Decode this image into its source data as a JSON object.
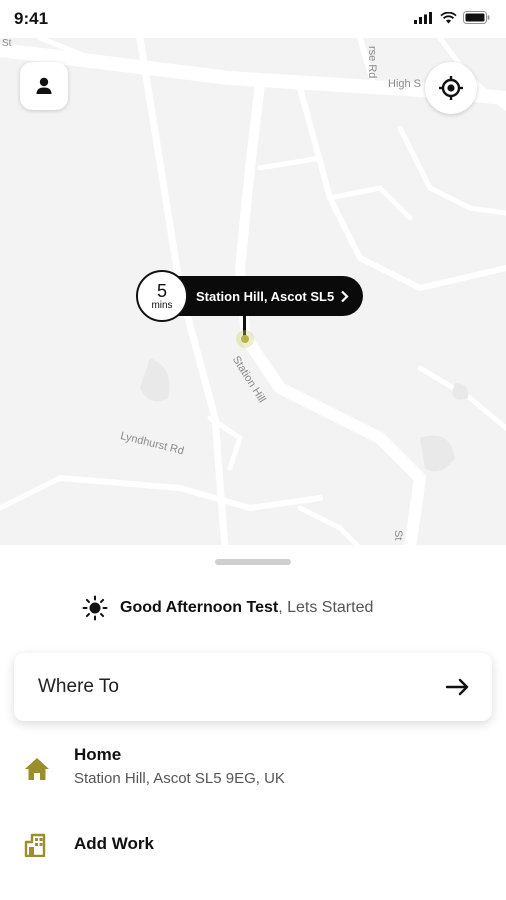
{
  "status_bar": {
    "time": "9:41"
  },
  "map": {
    "labels": {
      "st_top_left": "St",
      "rose_rd": "rse Rd",
      "high_st": "High S",
      "station_hill": "Station Hill",
      "lyndhurst_rd": "Lyndhurst Rd",
      "st_bottom_right": "St"
    },
    "eta": {
      "value": "5",
      "unit": "mins",
      "location": "Station Hill, Ascot SL5"
    },
    "pin_color": "#b8b24e"
  },
  "sheet": {
    "greeting_name": "Good Afternoon Test",
    "greeting_sub": ", Lets Started",
    "where_to": "Where To",
    "places": [
      {
        "icon": "home-icon",
        "title": "Home",
        "subtitle": "Station Hill, Ascot SL5 9EG, UK"
      },
      {
        "icon": "work-icon",
        "title": "Add Work"
      }
    ],
    "accent_color": "#9a8f2a"
  }
}
